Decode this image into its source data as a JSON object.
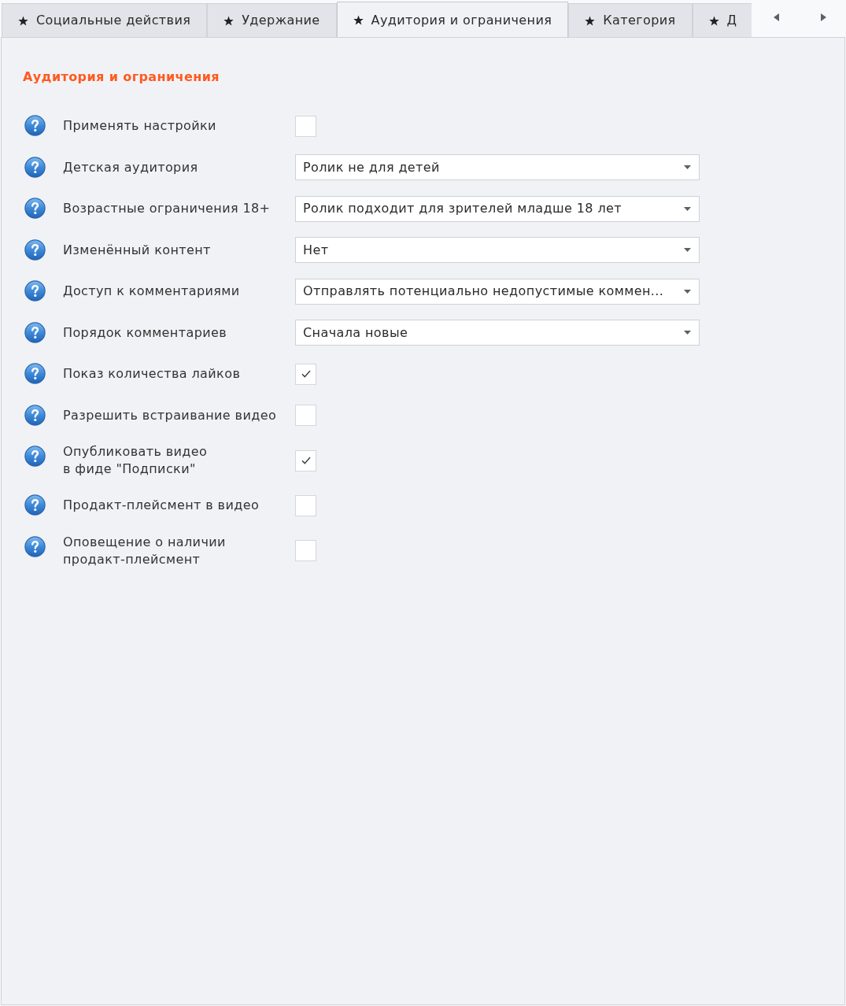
{
  "tabs": [
    {
      "label": "Социальные действия",
      "selected": false
    },
    {
      "label": "Удержание",
      "selected": false
    },
    {
      "label": "Аудитория и ограничения",
      "selected": true
    },
    {
      "label": "Категория",
      "selected": false
    },
    {
      "label": "Д",
      "selected": false
    }
  ],
  "panel": {
    "title": "Аудитория и ограничения",
    "settings": [
      {
        "kind": "checkbox",
        "label": "Применять настройки",
        "checked": false
      },
      {
        "kind": "dropdown",
        "label": "Детская аудитория",
        "value": "Ролик не для детей"
      },
      {
        "kind": "dropdown",
        "label": "Возрастные ограничения 18+",
        "value": "Ролик подходит для зрителей младше 18 лет"
      },
      {
        "kind": "dropdown",
        "label": "Изменённый контент",
        "value": "Нет"
      },
      {
        "kind": "dropdown",
        "label": "Доступ к комментариями",
        "value": "Отправлять потенциально недопустимые коммен..."
      },
      {
        "kind": "dropdown",
        "label": "Порядок комментариев",
        "value": "Сначала новые"
      },
      {
        "kind": "checkbox",
        "label": "Показ количества лайков",
        "checked": true
      },
      {
        "kind": "checkbox",
        "label": "Разрешить встраивание видео",
        "checked": false
      },
      {
        "kind": "checkbox",
        "label": "Опубликовать видео\nв фиде \"Подписки\"",
        "checked": true
      },
      {
        "kind": "checkbox",
        "label": "Продакт-плейсмент в видео",
        "checked": false
      },
      {
        "kind": "checkbox",
        "label": "Оповещение о наличии\nпродакт-плейсмент",
        "checked": false
      }
    ]
  }
}
